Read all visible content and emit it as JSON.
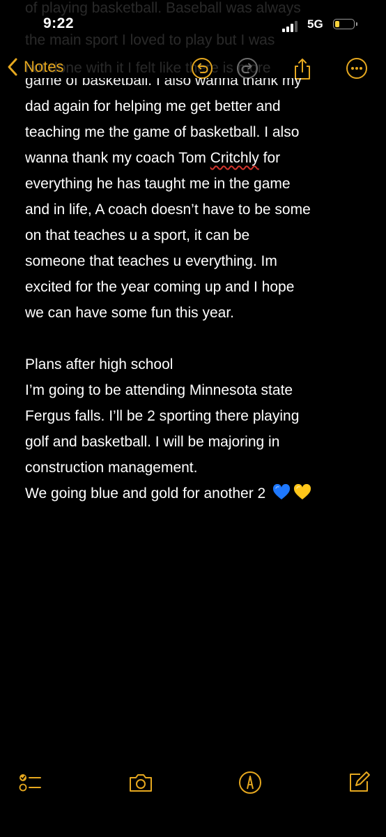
{
  "status_bar": {
    "time": "9:22",
    "network": "5G",
    "battery_level": 0.25,
    "signal_bars": 3,
    "accent_color": "#f6d23c"
  },
  "scrolled_text": {
    "line_1": "of playing basketball. Baseball was always",
    "line_2": "the main sport I loved to play but I was",
    "line_3": "not done with it I felt like there is more"
  },
  "nav": {
    "back_label": "Notes",
    "icons": [
      "chevron-left-icon",
      "undo-icon",
      "redo-icon",
      "share-icon",
      "more-icon"
    ],
    "accent_color": "#e6a81f"
  },
  "note": {
    "lines": [
      "game of basketball. I also wanna thank my",
      "dad again for helping me get better and",
      "teaching me the game of basketball. I also",
      "wanna thank my coach Tom ",
      "Critchly",
      " for",
      "everything he has taught me in the game",
      "and in life, A coach doesn’t have to be some",
      "on that teaches u a sport, it can be",
      "someone that teaches u everything. Im",
      "excited for the year coming up and I hope",
      "we can have some fun this year.",
      "",
      "Plans after high school",
      "I’m going to be attending Minnesota state",
      "Fergus falls. I’ll be 2 sporting there playing",
      "golf and basketball. I will be majoring in",
      "construction management.",
      "We going blue and gold for another 2"
    ],
    "emoji": [
      "blue-heart",
      "yellow-heart"
    ]
  },
  "toolbar": {
    "icons": [
      "checklist-icon",
      "camera-icon",
      "markup-icon",
      "compose-icon"
    ],
    "accent_color": "#e6a81f"
  }
}
